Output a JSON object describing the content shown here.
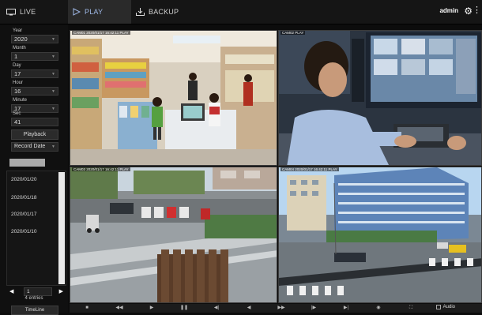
{
  "header": {
    "tabs": [
      {
        "label": "LIVE",
        "icon": "monitor-icon"
      },
      {
        "label": "PLAY",
        "icon": "play-icon"
      },
      {
        "label": "BACKUP",
        "icon": "download-icon"
      }
    ],
    "user": "admin",
    "settings_icon": "gear-icon"
  },
  "sidebar": {
    "fields": [
      {
        "label": "Year",
        "value": "2020"
      },
      {
        "label": "Month",
        "value": "1"
      },
      {
        "label": "Day",
        "value": "17"
      },
      {
        "label": "Hour",
        "value": "16"
      },
      {
        "label": "Minute",
        "value": "17"
      },
      {
        "label": "Sec",
        "value": "41"
      }
    ],
    "playback_label": "Playback",
    "record_select": "Record Date",
    "dates": [
      "2020/01/20",
      "2020/01/18",
      "2020/01/17",
      "2020/01/10"
    ],
    "page": "1",
    "entries": "4 entries",
    "timeline_label": "TimeLine"
  },
  "cameras": [
    {
      "label": "CAM01 2020/01/17 16:42:11 PLAY"
    },
    {
      "label": "CAM02 PLAY"
    },
    {
      "label": "CAM03 2020/01/17 16:42:11 PLAY"
    },
    {
      "label": "CAM04 2020/01/17 16:42:11 PLAY"
    }
  ],
  "controls": {
    "audio_label": "Audio"
  },
  "colors": {
    "accent": "#9fb8e6",
    "background": "#0c0c0c"
  }
}
